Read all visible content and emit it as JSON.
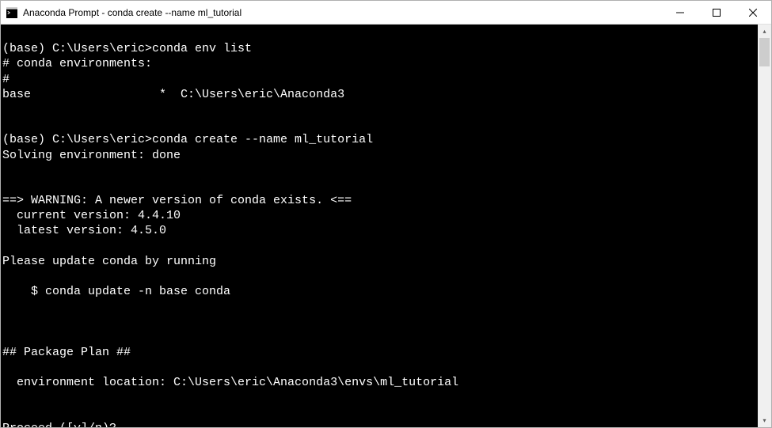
{
  "window": {
    "title": "Anaconda Prompt - conda  create --name ml_tutorial"
  },
  "terminal": {
    "lines": [
      "",
      "(base) C:\\Users\\eric>conda env list",
      "# conda environments:",
      "#",
      "base                  *  C:\\Users\\eric\\Anaconda3",
      "",
      "",
      "(base) C:\\Users\\eric>conda create --name ml_tutorial",
      "Solving environment: done",
      "",
      "",
      "==> WARNING: A newer version of conda exists. <==",
      "  current version: 4.4.10",
      "  latest version: 4.5.0",
      "",
      "Please update conda by running",
      "",
      "    $ conda update -n base conda",
      "",
      "",
      "",
      "## Package Plan ##",
      "",
      "  environment location: C:\\Users\\eric\\Anaconda3\\envs\\ml_tutorial",
      "",
      "",
      "Proceed ([y]/n)?"
    ]
  }
}
